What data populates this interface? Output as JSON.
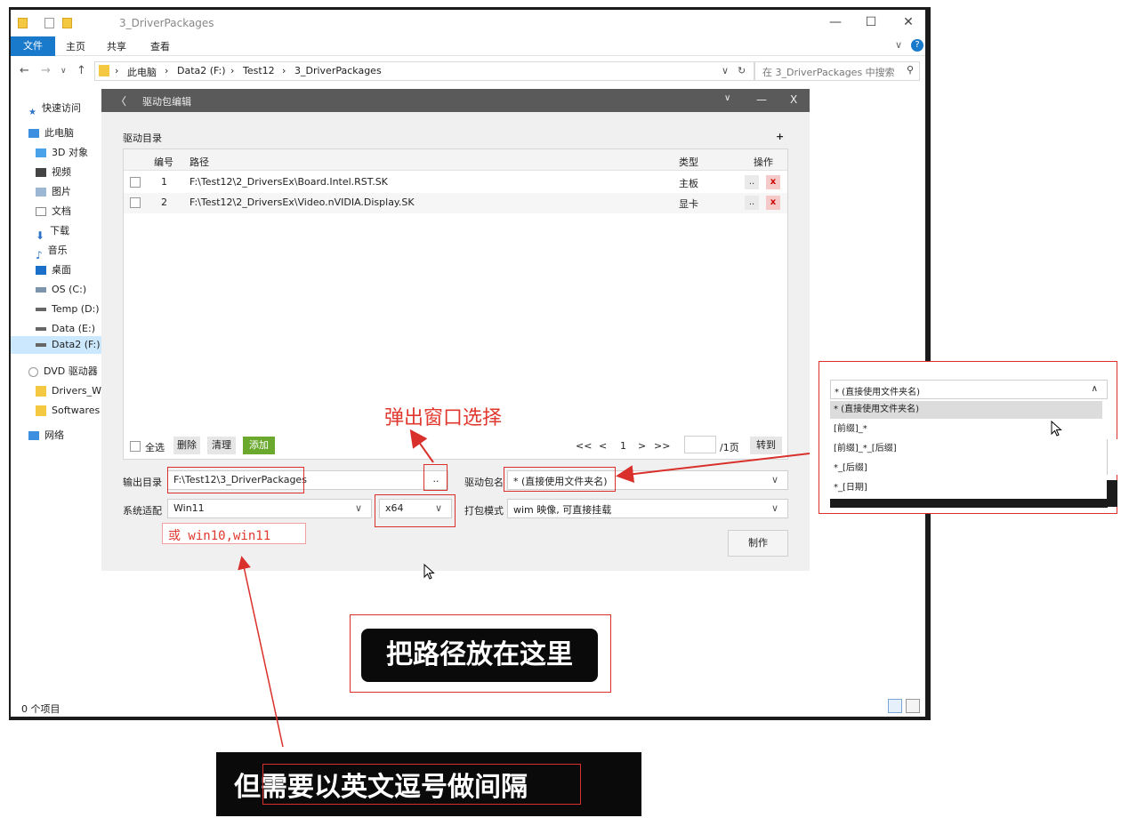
{
  "window": {
    "title": "3_DriverPackages",
    "ribbon_tabs": [
      "文件",
      "主页",
      "共享",
      "查看"
    ],
    "breadcrumbs": [
      "此电脑",
      "Data2 (F:)",
      "Test12",
      "3_DriverPackages"
    ],
    "search_placeholder": "在 3_DriverPackages 中搜索",
    "status": "0 个项目"
  },
  "sidebar": {
    "items": [
      {
        "label": "快速访问",
        "icon": "star-icon"
      },
      {
        "label": "此电脑",
        "icon": "computer-icon"
      },
      {
        "label": "3D 对象",
        "icon": "cube-icon"
      },
      {
        "label": "视频",
        "icon": "video-icon"
      },
      {
        "label": "图片",
        "icon": "picture-icon"
      },
      {
        "label": "文档",
        "icon": "document-icon"
      },
      {
        "label": "下载",
        "icon": "download-icon"
      },
      {
        "label": "音乐",
        "icon": "music-icon"
      },
      {
        "label": "桌面",
        "icon": "desktop-icon"
      },
      {
        "label": "OS (C:)",
        "icon": "drive-icon"
      },
      {
        "label": "Temp (D:)",
        "icon": "drive-icon"
      },
      {
        "label": "Data (E:)",
        "icon": "drive-icon"
      },
      {
        "label": "Data2 (F:)",
        "icon": "drive-icon"
      },
      {
        "label": "DVD 驱动器",
        "icon": "disc-icon"
      },
      {
        "label": "Drivers_Wi",
        "icon": "folder-icon"
      },
      {
        "label": "Softwares",
        "icon": "folder-icon"
      },
      {
        "label": "网络",
        "icon": "network-icon"
      }
    ]
  },
  "dialog": {
    "back": "〈",
    "title": "驱动包编辑",
    "controls": [
      "∨",
      "—",
      "X"
    ],
    "section_label": "驱动目录",
    "add_symbol": "+",
    "columns": {
      "num": "编号",
      "path": "路径",
      "type": "类型",
      "ops": "操作"
    },
    "rows": [
      {
        "num": "1",
        "path": "F:\\Test12\\2_DriversEx\\Board.Intel.RST.SK",
        "type": "主板"
      },
      {
        "num": "2",
        "path": "F:\\Test12\\2_DriversEx\\Video.nVIDIA.Display.SK",
        "type": "显卡"
      }
    ],
    "row_dots": "..",
    "row_x": "x",
    "select_all": "全选",
    "delete": "删除",
    "clear": "清理",
    "add": "添加",
    "pager": {
      "first": "<<",
      "prev": "<",
      "page": "1",
      "next": ">",
      "last": ">>",
      "total": "/1页",
      "goto": "转到"
    },
    "output_label": "输出目录",
    "output_value": "F:\\Test12\\3_DriverPackages",
    "browse": "..",
    "pkgname_label": "驱动包名",
    "pkgname_value": "* (直接使用文件夹名)",
    "system_label": "系统适配",
    "system_value": "Win11",
    "arch_value": "x64",
    "mode_label": "打包模式",
    "mode_value": "wim 映像, 可直接挂载",
    "make": "制作"
  },
  "popup": {
    "field_value": "* (直接使用文件夹名)",
    "caret": "∧",
    "options": [
      "* (直接使用文件夹名)",
      "[前缀]_*",
      "[前缀]_*_[后缀]",
      "*_[后缀]",
      "*_[日期]"
    ]
  },
  "annotations": {
    "popup_hint": "弹出窗口选择",
    "system_hint": "或 win10,win11",
    "path_here": "把路径放在这里",
    "comma_note": "但需要以英文逗号做间隔"
  },
  "colors": {
    "accent": "#1979ca",
    "annotation_red": "#d9302c",
    "add_green": "#6aa82e"
  }
}
